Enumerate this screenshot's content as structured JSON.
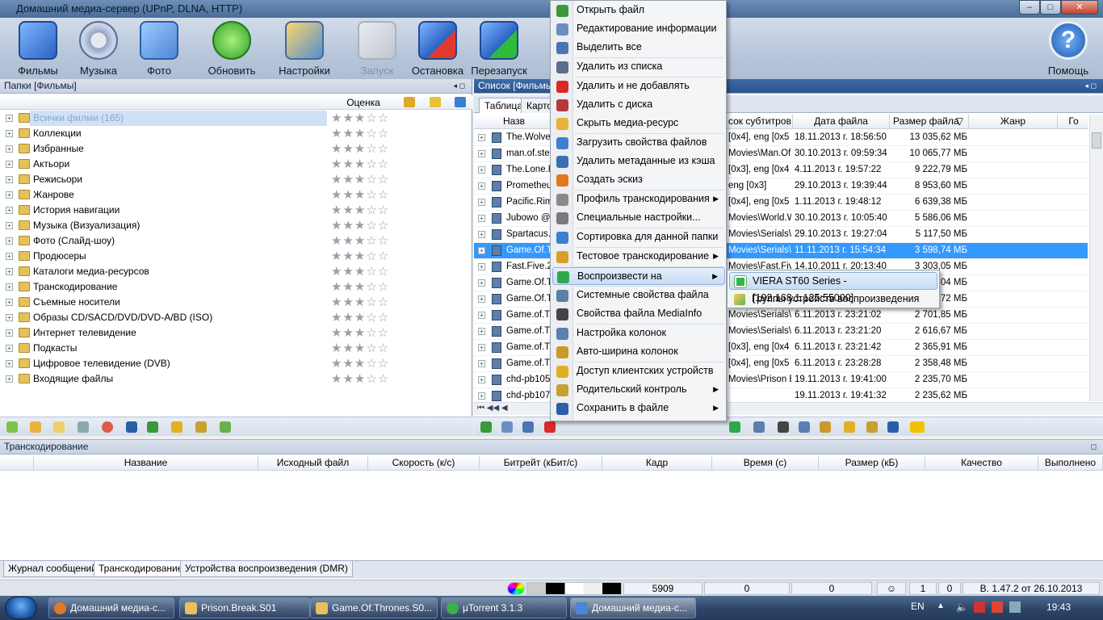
{
  "window": {
    "title": "Домашний медиа-сервер (UPnP, DLNA, HTTP)",
    "minimize": "–",
    "maximize": "□",
    "close": "✕"
  },
  "toolbar": {
    "movies": "Фильмы",
    "music": "Музыка",
    "photo": "Фото",
    "refresh": "Обновить",
    "settings": "Настройки",
    "start": "Запуск",
    "stop": "Остановка",
    "restart": "Перезапуск",
    "help": "Помощь"
  },
  "left": {
    "header": "Папки [Фильмы]",
    "col_rating": "Оценка",
    "stars": "★★★☆☆",
    "items": [
      {
        "label": "Всички филми (165)"
      },
      {
        "label": "Коллекции"
      },
      {
        "label": "Избранные"
      },
      {
        "label": "Актьори"
      },
      {
        "label": "Режисьори"
      },
      {
        "label": "Жанрове"
      },
      {
        "label": "История навигации"
      },
      {
        "label": "Музыка (Визуализация)"
      },
      {
        "label": "Фото (Слайд-шоу)"
      },
      {
        "label": "Продюсеры"
      },
      {
        "label": "Каталоги медиа-ресурсов"
      },
      {
        "label": "Транскодирование"
      },
      {
        "label": "Съемные носители"
      },
      {
        "label": "Образы CD/SACD/DVD/DVD-A/BD (ISO)"
      },
      {
        "label": "Интернет телевидение"
      },
      {
        "label": "Подкасты"
      },
      {
        "label": "Цифровое телевидение (DVB)"
      },
      {
        "label": "Входящие файлы"
      }
    ]
  },
  "right": {
    "header": "Список [Фильмы]",
    "tabs": [
      "Таблица",
      "Карто"
    ],
    "columns": {
      "name": "Назв",
      "subs": "сок субтитров",
      "date": "Дата файла",
      "size": "Размер файла",
      "sort": "▽",
      "genre": "Жанр",
      "go": "Го"
    },
    "rows": [
      {
        "name": "The.Wolve",
        "subs": "[0x4], eng [0x5",
        "date": "18.11.2013 г. 18:56:50",
        "size": "13 035,62 МБ"
      },
      {
        "name": "man.of.ste",
        "subs": "Movies\\Man.Of.S",
        "date": "30.10.2013 г. 09:59:34",
        "size": "10 065,77 МБ"
      },
      {
        "name": "The.Lone.R",
        "subs": "[0x3], eng [0x4",
        "date": "4.11.2013 г. 19:57:22",
        "size": "9 222,79 МБ"
      },
      {
        "name": "Prometheu",
        "subs": "eng [0x3]",
        "date": "29.10.2013 г. 19:39:44",
        "size": "8 953,60 МБ"
      },
      {
        "name": "Pacific.Rim",
        "subs": "[0x4], eng [0x5",
        "date": "1.11.2013 г. 19:48:12",
        "size": "6 639,38 МБ"
      },
      {
        "name": "Jubowo @",
        "subs": "Movies\\World.W",
        "date": "30.10.2013 г. 10:05:40",
        "size": "5 586,06 МБ"
      },
      {
        "name": "Spartacus.",
        "subs": "Movies\\Serials\\S",
        "date": "29.10.2013 г. 19:27:04",
        "size": "5 117,50 МБ"
      },
      {
        "name": "Game.Of.T",
        "subs": "Movies\\Serials\\G",
        "date": "11.11.2013 г. 15:54:34",
        "size": "3 598,74 МБ",
        "sel": true
      },
      {
        "name": "Fast.Five.2",
        "subs": "Movies\\Fast.Five",
        "date": "14.10.2011 г. 20:13:40",
        "size": "3 303,05 МБ"
      },
      {
        "name": "Game.Of.T",
        "subs": "",
        "date": "",
        "size": "04 МБ"
      },
      {
        "name": "Game.Of.T",
        "subs": "",
        "date": "",
        "size": "72 МБ"
      },
      {
        "name": "Game.of.Th",
        "subs": "Movies\\Serials\\G",
        "date": "6.11.2013 г. 23:21:02",
        "size": "2 701,85 МБ"
      },
      {
        "name": "Game.of.Th",
        "subs": "Movies\\Serials\\G",
        "date": "6.11.2013 г. 23:21:20",
        "size": "2 616,67 МБ"
      },
      {
        "name": "Game.of.T",
        "subs": "[0x3], eng [0x4",
        "date": "6.11.2013 г. 23:21:42",
        "size": "2 365,91 МБ"
      },
      {
        "name": "Game.of.Th",
        "subs": "[0x4], eng [0x5",
        "date": "6.11.2013 г. 23:28:28",
        "size": "2 358,48 МБ"
      },
      {
        "name": "chd-pb105",
        "subs": "Movies\\Prison Br",
        "date": "19.11.2013 г. 19:41:00",
        "size": "2 235,70 МБ"
      },
      {
        "name": "chd-pb107",
        "subs": "",
        "date": "19.11.2013 г. 19:41:32",
        "size": "2 235,62 МБ"
      }
    ]
  },
  "transcode": {
    "header": "Транскодирование",
    "columns": [
      "Название",
      "Исходный файл",
      "Скорость (к/с)",
      "Битрейт (кБит/с)",
      "Кадр",
      "Время (с)",
      "Размер (кБ)",
      "Качество",
      "Выполнено"
    ]
  },
  "bottom_tabs": [
    "Журнал сообщений",
    "Транскодирование",
    "Устройства воспроизведения (DMR)"
  ],
  "status": {
    "count": "5909",
    "v1": "0",
    "v2": "0",
    "v3": "1",
    "v4": "0",
    "version": "В. 1.47.2 от 26.10.2013"
  },
  "taskbar": {
    "tasks": [
      "Домашний медиа-с...",
      "Prison.Break.S01",
      "Game.Of.Thrones.S0...",
      "µTorrent 3.1.3",
      "Домашний медиа-с..."
    ],
    "lang": "EN",
    "time": "19:43"
  },
  "context_menu": [
    {
      "label": "Открыть файл",
      "color": "#3a9a3a"
    },
    {
      "label": "Редактирование информации",
      "color": "#6a8fc0"
    },
    {
      "label": "Выделить все",
      "color": "#4a74b4"
    },
    {
      "label": "Удалить из списка",
      "color": "#5a6e8c"
    },
    {
      "label": "Удалить и не добавлять",
      "color": "#d92a2a"
    },
    {
      "label": "Удалить с диска",
      "color": "#b53a3a"
    },
    {
      "label": "Скрыть медиа-ресурс",
      "color": "#e8b23c"
    },
    {
      "label": "Загрузить свойства файлов",
      "color": "#3f7fd0"
    },
    {
      "label": "Удалить метаданные из кэша",
      "color": "#3a6fb8"
    },
    {
      "label": "Создать эскиз",
      "color": "#e0781e"
    },
    {
      "label": "Профиль транскодирования",
      "color": "#8a8a8a"
    },
    {
      "label": "Специальные настройки...",
      "color": "#7a7a7a"
    },
    {
      "label": "Сортировка для данной папки",
      "color": "#3a7fd0"
    },
    {
      "label": "Тестовое транскодирование",
      "color": "#d8a02a"
    },
    {
      "label": "Воспроизвести на",
      "color": "#2fa84a"
    },
    {
      "label": "Системные свойства файла",
      "color": "#5a7fa8"
    },
    {
      "label": "Свойства файла MediaInfo",
      "color": "#444"
    },
    {
      "label": "Настройка колонок",
      "color": "#5a7fb0"
    },
    {
      "label": "Авто-ширина колонок",
      "color": "#c89a2a"
    },
    {
      "label": "Доступ клиентских устройств",
      "color": "#e0b020"
    },
    {
      "label": "Родительский контроль",
      "color": "#c8a030"
    },
    {
      "label": "Сохранить в файле",
      "color": "#2a5fa8"
    }
  ],
  "submenu": [
    "VIERA ST60 Series - [192.168.1.125:55000]",
    "Группы устройств воспроизведения"
  ]
}
